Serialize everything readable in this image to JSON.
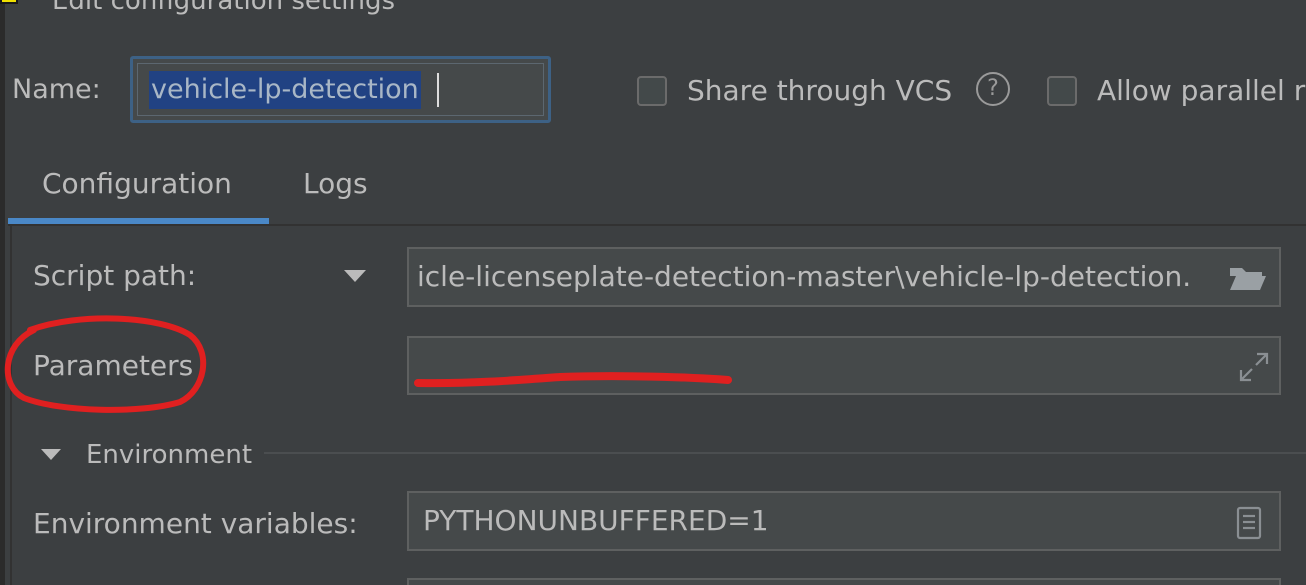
{
  "window": {
    "title": "Edit configuration settings"
  },
  "header": {
    "name_label": "Name:",
    "name_value": "vehicle-lp-detection",
    "share_vcs_label": "Share through VCS",
    "share_vcs_checked": false,
    "help_glyph": "?",
    "allow_parallel_label": "Allow parallel r",
    "allow_parallel_checked": false
  },
  "tabs": [
    {
      "label": "Configuration",
      "selected": true
    },
    {
      "label": "Logs",
      "selected": false
    }
  ],
  "form": {
    "script_path_label": "Script path:",
    "script_path_value": "icle-licenseplate-detection-master\\vehicle-lp-detection.",
    "parameters_label": "Parameters",
    "parameters_value": "",
    "environment_section_label": "Environment",
    "env_vars_label": "Environment variables:",
    "env_vars_value": "PYTHONUNBUFFERED=1"
  },
  "icons": {
    "app": "app-icon",
    "help": "help-icon",
    "dropdown": "chevron-down-icon",
    "folder": "folder-icon",
    "expand": "expand-icon",
    "env_edit": "document-icon",
    "section_toggle": "triangle-down-icon"
  },
  "colors": {
    "background": "#3c3f41",
    "accent": "#4a88c7",
    "selection": "#214283",
    "annotation": "#e02020"
  }
}
